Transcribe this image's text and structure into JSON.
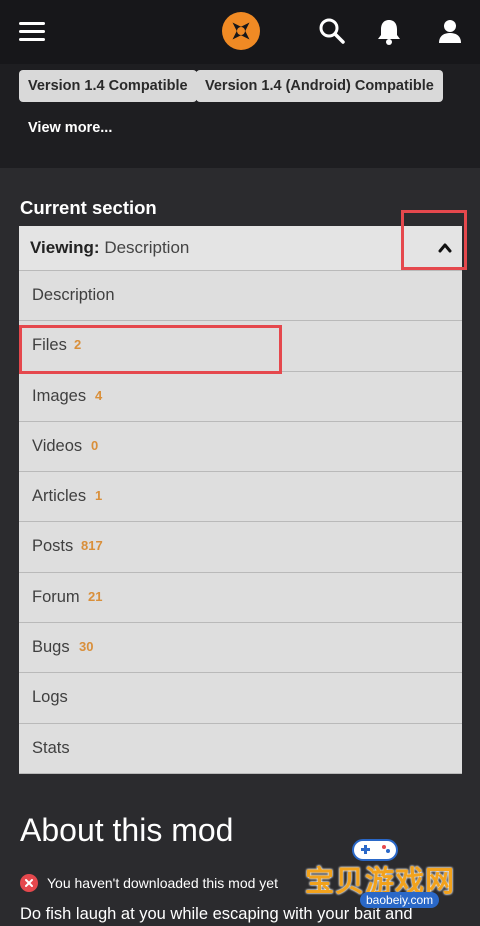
{
  "topbar": {
    "menu_icon": "hamburger-menu-icon",
    "logo_icon": "nexus-logo",
    "icons": [
      "search-icon",
      "bell-icon",
      "user-icon"
    ]
  },
  "tags": [
    "Version 1.4 Compatible",
    "Version 1.4 (Android) Compatible"
  ],
  "view_more": "View more...",
  "current_section": {
    "heading": "Current section",
    "viewing_label": "Viewing:",
    "viewing_value": "Description",
    "items": [
      {
        "name": "Description",
        "count": ""
      },
      {
        "name": "Files",
        "count": "2"
      },
      {
        "name": "Images",
        "count": "4"
      },
      {
        "name": "Videos",
        "count": "0"
      },
      {
        "name": "Articles",
        "count": "1"
      },
      {
        "name": "Posts",
        "count": "817"
      },
      {
        "name": "Forum",
        "count": "21"
      },
      {
        "name": "Bugs",
        "count": "30"
      },
      {
        "name": "Logs",
        "count": ""
      },
      {
        "name": "Stats",
        "count": ""
      }
    ]
  },
  "about": {
    "title": "About this mod",
    "notice": "You haven't downloaded this mod yet",
    "description": "Do fish laugh at you while escaping with your bait and"
  },
  "watermark": {
    "cn": "宝贝游戏网",
    "en": "baobeiy.com"
  },
  "colors": {
    "count_accent": "#d98f3a",
    "highlight": "#e5484d",
    "logo_orange": "#f08a24"
  }
}
